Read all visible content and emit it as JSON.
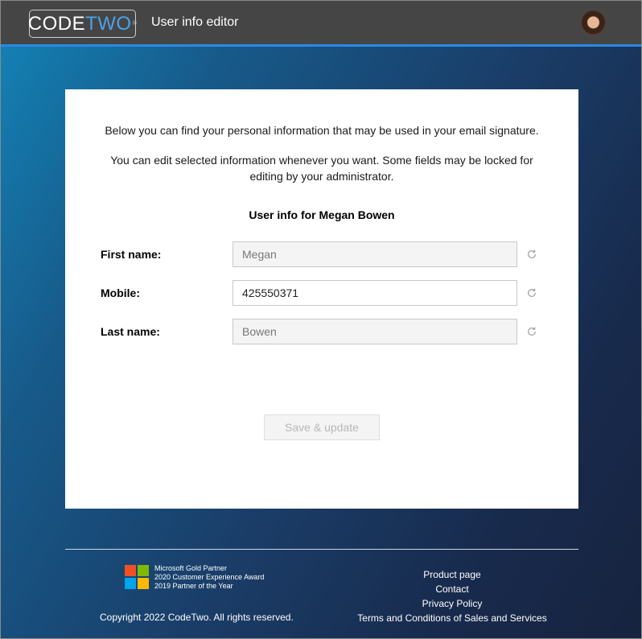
{
  "header": {
    "logo_code": "CODE",
    "logo_two": "TWO",
    "logo_reg": "®",
    "title": "User info editor",
    "avatar": "user-avatar"
  },
  "card": {
    "intro_line1": "Below you can find your personal information that may be used in your email signature.",
    "intro_line2": "You can edit selected information whenever you want. Some fields may be locked for editing by your administrator.",
    "user_heading": "User info for Megan Bowen",
    "fields": [
      {
        "label": "First name:",
        "value": "Megan",
        "locked": true,
        "icon": "reset-icon"
      },
      {
        "label": "Mobile:",
        "value": "425550371",
        "locked": false,
        "icon": "reset-icon"
      },
      {
        "label": "Last name:",
        "value": "Bowen",
        "locked": true,
        "icon": "reset-icon"
      }
    ],
    "save_label": "Save & update"
  },
  "footer": {
    "partner_lines": [
      "Microsoft Gold Partner",
      "2020 Customer Experience Award",
      "2019 Partner of the Year"
    ],
    "copyright": "Copyright 2022 CodeTwo. All rights reserved.",
    "links": [
      "Product page",
      "Contact",
      "Privacy Policy",
      "Terms and Conditions of Sales and Services"
    ]
  },
  "colors": {
    "accent": "#2b8ae2",
    "header_bg": "#454545",
    "ms_red": "#f25022",
    "ms_green": "#7fba00",
    "ms_blue": "#00a4ef",
    "ms_yellow": "#ffb900"
  }
}
